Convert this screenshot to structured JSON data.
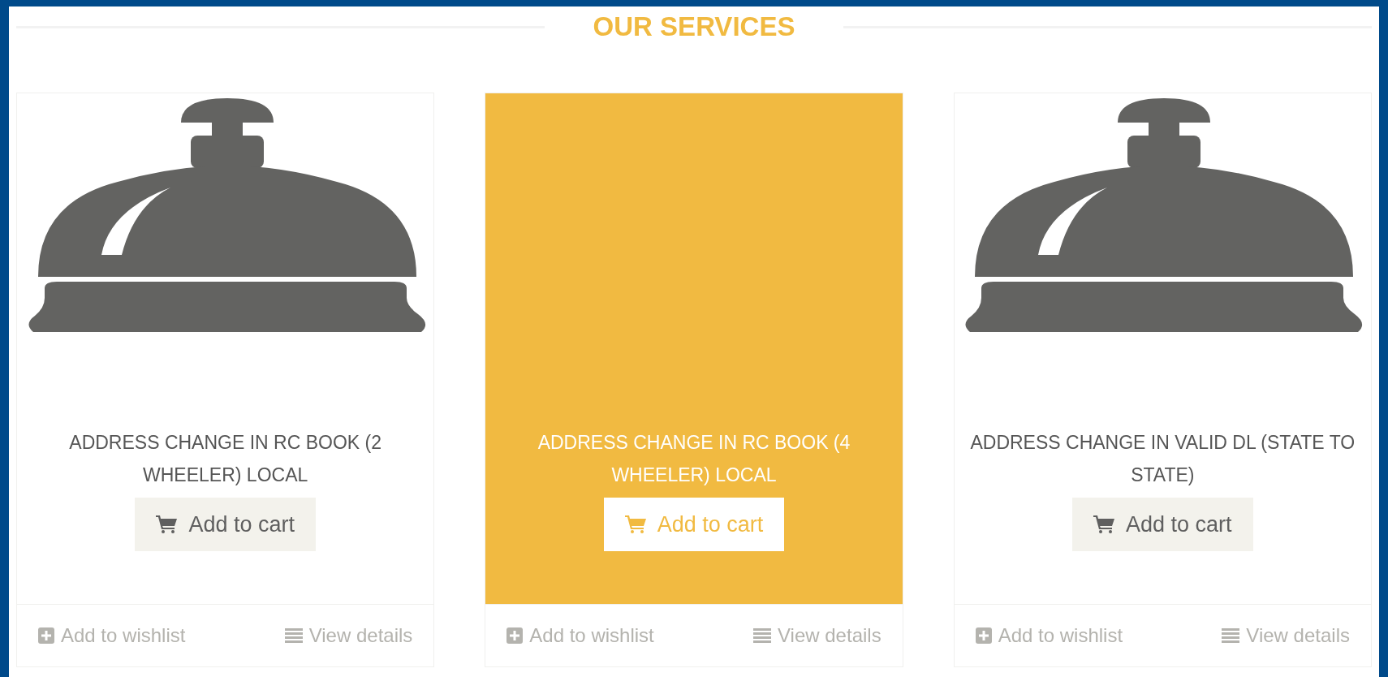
{
  "heading": "OUR SERVICES",
  "products": [
    {
      "title": "ADDRESS CHANGE IN RC BOOK (2 WHEELER) LOCAL",
      "highlighted": false,
      "cart_button": "Add to cart",
      "wishlist_link": "Add to wishlist",
      "details_link": "View details"
    },
    {
      "title": "ADDRESS CHANGE IN RC BOOK (4 WHEELER) LOCAL",
      "highlighted": true,
      "cart_button": "Add to cart",
      "wishlist_link": "Add to wishlist",
      "details_link": "View details"
    },
    {
      "title": "ADDRESS CHANGE IN VALID DL (STATE TO STATE)",
      "highlighted": false,
      "cart_button": "Add to cart",
      "wishlist_link": "Add to wishlist",
      "details_link": "View details"
    }
  ]
}
